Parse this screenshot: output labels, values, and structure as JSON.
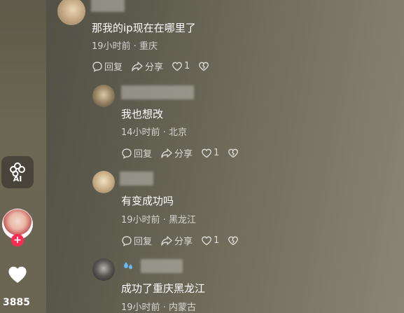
{
  "sidebar": {
    "ai_label": "AI",
    "like_count": "3885"
  },
  "comments": [
    {
      "text": "那我的ip现在在哪里了",
      "meta": "19小时前 · 重庆",
      "reply": "回复",
      "share": "分享",
      "likes": "1"
    },
    {
      "text": "我也想改",
      "meta": "14小时前 · 北京",
      "reply": "回复",
      "share": "分享",
      "likes": "1"
    },
    {
      "text": "有变成功吗",
      "meta": "19小时前 · 黑龙江",
      "reply": "回复",
      "share": "分享",
      "likes": "1"
    },
    {
      "text": "成功了重庆黑龙江",
      "meta": "19小时前 · 内蒙古"
    }
  ],
  "colors": {
    "follow": "#fe2c55",
    "badge": "#6ab7f0"
  }
}
